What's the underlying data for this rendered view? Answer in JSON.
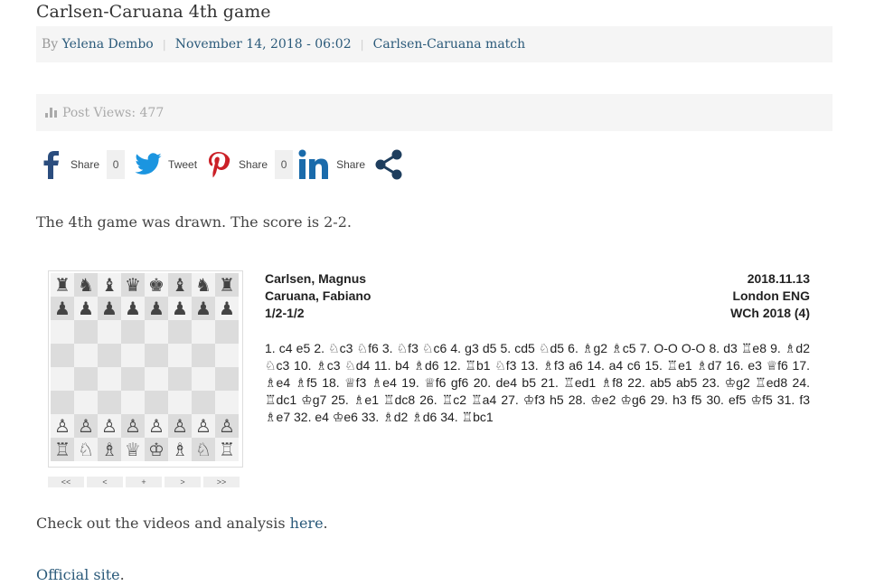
{
  "post": {
    "title": "Carlsen-Caruana 4th game",
    "by_label": "By",
    "author": "Yelena Dembo",
    "date": "November 14, 2018 - 06:02",
    "category": "Carlsen-Caruana match",
    "separator": "|"
  },
  "views": {
    "icon": "bar-chart-icon",
    "text": "Post Views: 477"
  },
  "share": {
    "facebook": {
      "label": "Share",
      "count": "0",
      "icon": "facebook-icon"
    },
    "twitter": {
      "label": "Tweet",
      "icon": "twitter-icon"
    },
    "pinterest": {
      "label": "Share",
      "count": "0",
      "icon": "pinterest-icon"
    },
    "linkedin": {
      "label": "Share",
      "icon": "linkedin-icon"
    },
    "more": {
      "icon": "share-icon"
    }
  },
  "content": {
    "intro": "The 4th game was drawn. The score is 2-2.",
    "videos_prefix": "Check out the videos and analysis ",
    "videos_link": "here",
    "videos_suffix": ".",
    "official_link": "Official site",
    "official_suffix": "."
  },
  "game": {
    "white": "Carlsen, Magnus",
    "black": "Caruana, Fabiano",
    "result": "1/2-1/2",
    "date": "2018.11.13",
    "site": "London ENG",
    "event": "WCh 2018 (4)",
    "moves": "1. c4 e5 2. ♘c3 ♘f6 3. ♘f3 ♘c6 4. g3 d5 5. cd5 ♘d5 6. ♗g2 ♗c5 7. O-O O-O 8. d3 ♖e8 9. ♗d2 ♘c3 10. ♗c3 ♘d4 11. b4 ♗d6 12. ♖b1 ♘f3 13. ♗f3 a6 14. a4 c6 15. ♖e1 ♗d7 16. e3 ♕f6 17. ♗e4 ♗f5 18. ♕f3 ♗e4 19. ♕f6 gf6 20. de4 b5 21. ♖ed1 ♗f8 22. ab5 ab5 23. ♔g2 ♖ed8 24. ♖dc1 ♔g7 25. ♗e1 ♖dc8 26. ♖c2 ♖a4 27. ♔f3 h5 28. ♔e2 ♔g6 29. h3 f5 30. ef5 ♔f5 31. f3 ♗e7 32. e4 ♔e6 33. ♗d2 ♗d6 34. ♖bc1",
    "board": [
      [
        "♜",
        "♞",
        "♝",
        "♛",
        "♚",
        "♝",
        "♞",
        "♜"
      ],
      [
        "♟",
        "♟",
        "♟",
        "♟",
        "♟",
        "♟",
        "♟",
        "♟"
      ],
      [
        "",
        "",
        "",
        "",
        "",
        "",
        "",
        ""
      ],
      [
        "",
        "",
        "",
        "",
        "",
        "",
        "",
        ""
      ],
      [
        "",
        "",
        "",
        "",
        "",
        "",
        "",
        ""
      ],
      [
        "",
        "",
        "",
        "",
        "",
        "",
        "",
        ""
      ],
      [
        "♙",
        "♙",
        "♙",
        "♙",
        "♙",
        "♙",
        "♙",
        "♙"
      ],
      [
        "♖",
        "♘",
        "♗",
        "♕",
        "♔",
        "♗",
        "♘",
        "♖"
      ]
    ],
    "nav": [
      "<<",
      "<",
      "+",
      ">",
      ">>"
    ]
  }
}
